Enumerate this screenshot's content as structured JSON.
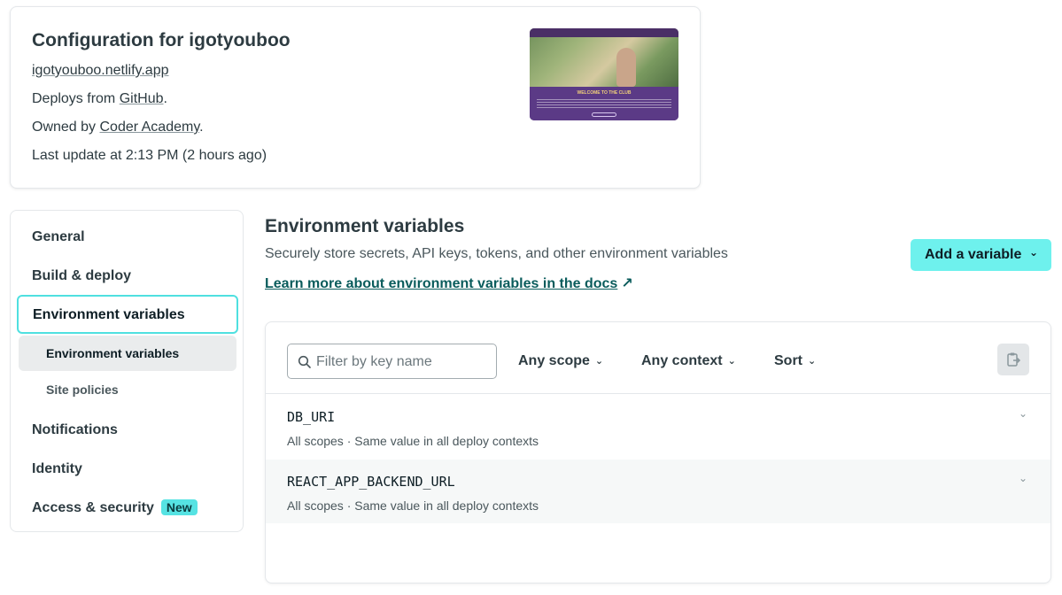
{
  "site": {
    "title": "Configuration for igotyouboo",
    "url": "igotyouboo.netlify.app",
    "deploys_prefix": "Deploys from ",
    "deploys_link": "GitHub",
    "deploys_suffix": ".",
    "owned_prefix": "Owned by ",
    "owned_link": "Coder Academy",
    "owned_suffix": ".",
    "last_update": "Last update at 2:13 PM (2 hours ago)",
    "thumbnail_headline": "WELCOME TO THE CLUB"
  },
  "sidenav": {
    "items": [
      {
        "label": "General"
      },
      {
        "label": "Build & deploy"
      },
      {
        "label": "Environment variables"
      },
      {
        "label": "Notifications"
      },
      {
        "label": "Identity"
      },
      {
        "label": "Access & security"
      }
    ],
    "sub_items": [
      {
        "label": "Environment variables"
      },
      {
        "label": "Site policies"
      }
    ],
    "new_badge": "New"
  },
  "main": {
    "title": "Environment variables",
    "subtitle": "Securely store secrets, API keys, tokens, and other environment variables",
    "docs_link": "Learn more about environment variables in the docs",
    "docs_arrow": "↗",
    "add_button": "Add a variable",
    "add_chevron": "⌄"
  },
  "filters": {
    "search_placeholder": "Filter by key name",
    "scope": "Any scope",
    "context": "Any context",
    "sort": "Sort",
    "chevron": "⌄"
  },
  "variables": [
    {
      "key": "DB_URI",
      "meta": "All scopes  ·  Same value in all deploy contexts"
    },
    {
      "key": "REACT_APP_BACKEND_URL",
      "meta": "All scopes  ·  Same value in all deploy contexts"
    }
  ],
  "colors": {
    "accent": "#6ef1ed",
    "active_border": "#4fe0e0",
    "badge": "#56e3e3",
    "link": "#0a5c5c"
  },
  "icons": {
    "search": "search-icon",
    "copy": "clipboard-copy-icon",
    "expand": "chevron-down-icon",
    "external": "external-link-arrow-icon"
  }
}
